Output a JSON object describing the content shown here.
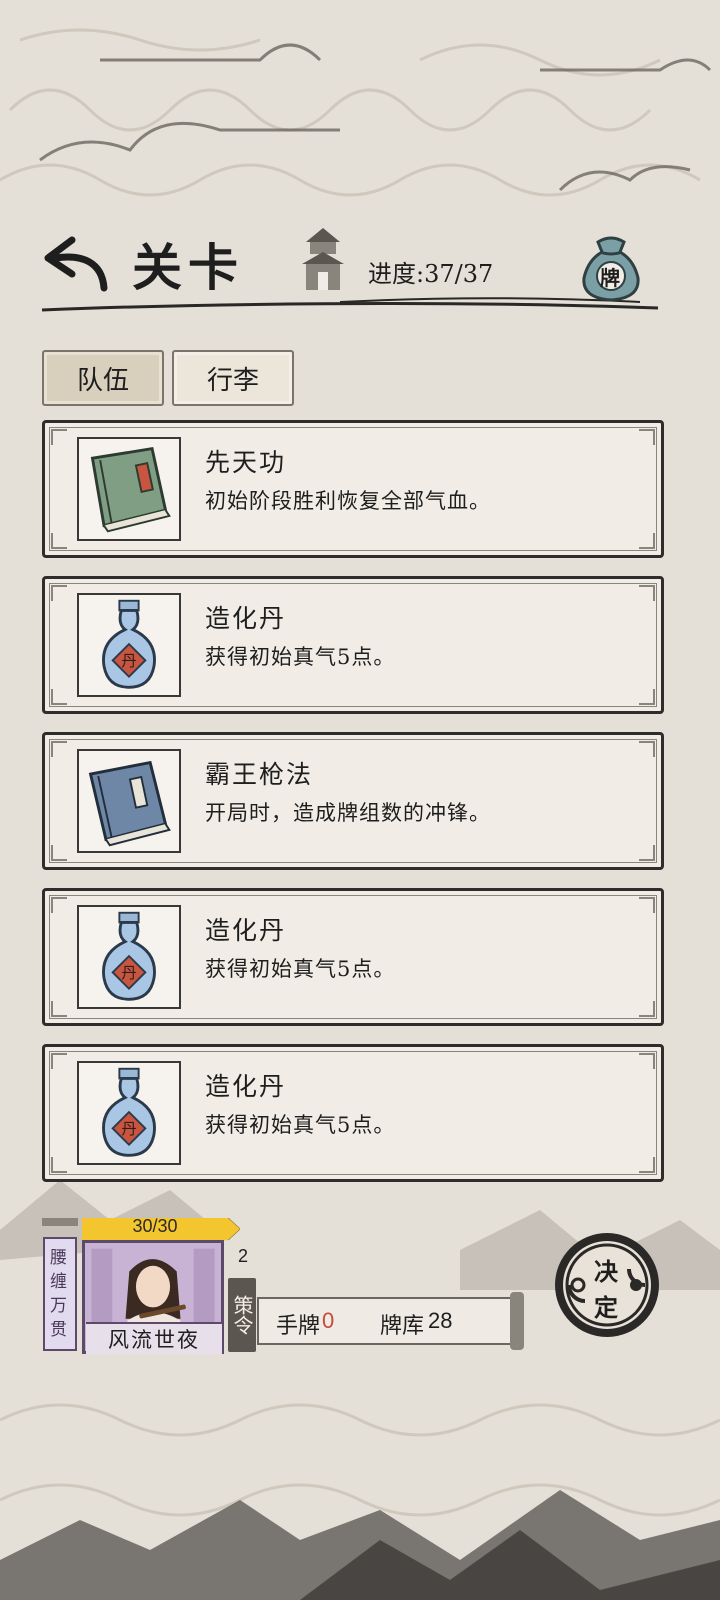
{
  "header": {
    "title": "关卡",
    "progress_label": "进度:",
    "progress_value": "37/37",
    "bag_label": "牌"
  },
  "tabs": [
    {
      "label": "队伍",
      "selected": true
    },
    {
      "label": "行李",
      "selected": false
    }
  ],
  "items": [
    {
      "name": "先天功",
      "desc": "初始阶段胜利恢复全部气血。",
      "icon": "green-book-icon"
    },
    {
      "name": "造化丹",
      "desc": "获得初始真气5点。",
      "icon": "elixir-bottle-icon"
    },
    {
      "name": "霸王枪法",
      "desc": "开局时，造成牌组数的冲锋。",
      "icon": "blue-book-icon"
    },
    {
      "name": "造化丹",
      "desc": "获得初始真气5点。",
      "icon": "elixir-bottle-icon"
    },
    {
      "name": "造化丹",
      "desc": "获得初始真气5点。",
      "icon": "elixir-bottle-icon"
    }
  ],
  "bottom": {
    "waist_label": "腰缠万贯",
    "hp": "30/30",
    "hp_fraction": 1.0,
    "hero_name": "风流世夜",
    "policy_count": "2",
    "policy_label": "策令",
    "hand_label": "手牌",
    "hand_value": "0",
    "deck_label": "牌库",
    "deck_value": "28",
    "decide_top": "决",
    "decide_bottom": "定"
  },
  "colors": {
    "background": "#e4dfd7",
    "card_bg": "#f1ede6",
    "hp_bar": "#f3c52e",
    "hand_zero": "#c64a3c",
    "portrait_bg": "#c9b3d4"
  }
}
